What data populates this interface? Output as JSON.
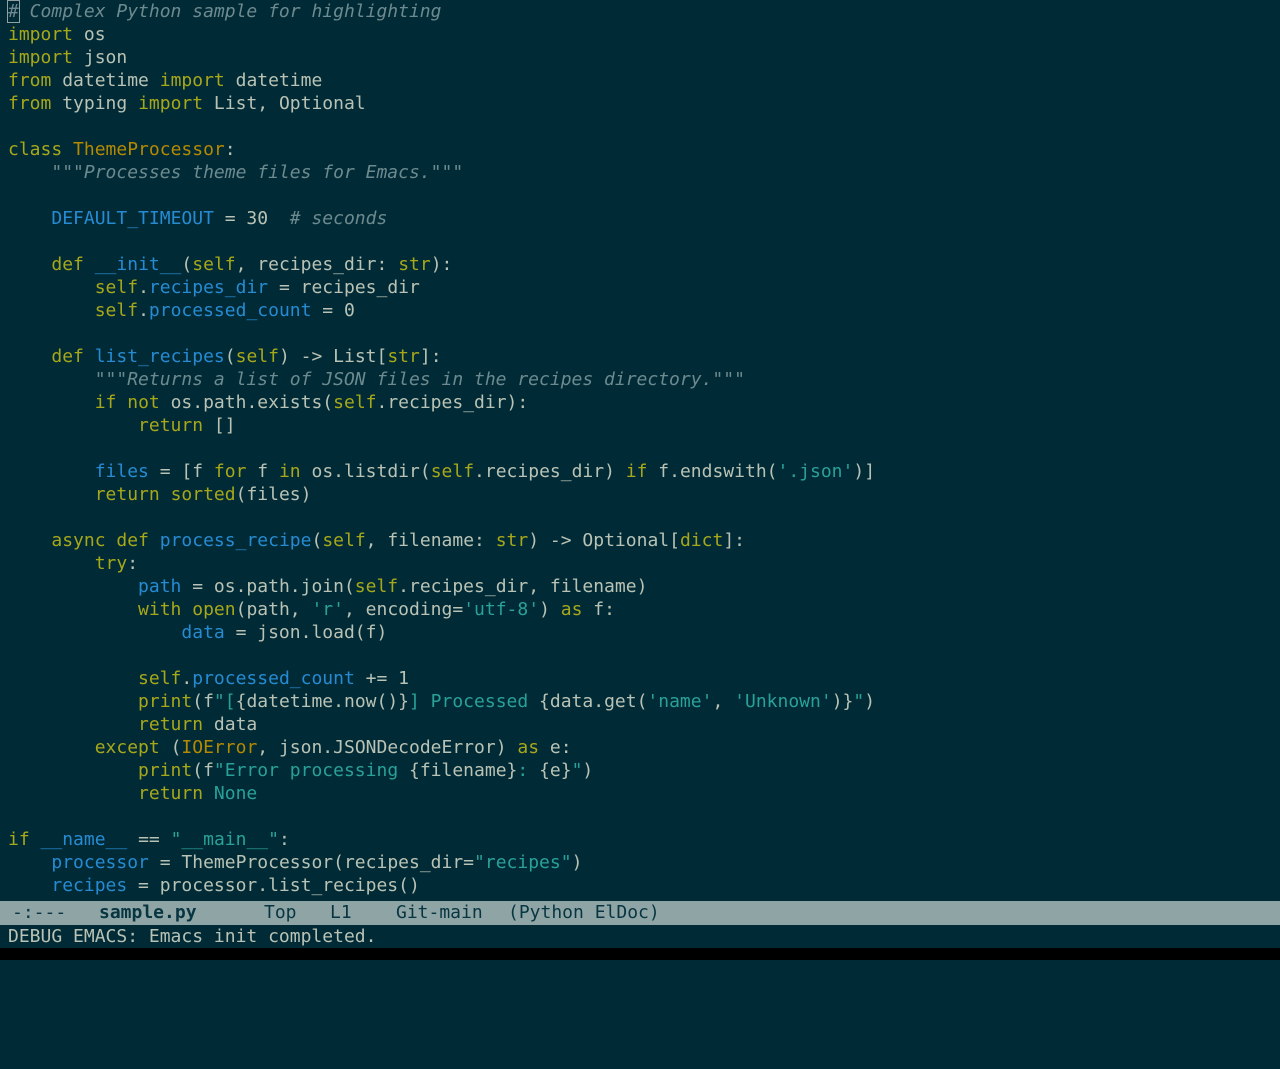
{
  "editor": {
    "lines": [
      [
        [
          "comment",
          "# Complex Python sample for highlighting"
        ]
      ],
      [
        [
          "kw",
          "import"
        ],
        [
          "plain",
          " os"
        ]
      ],
      [
        [
          "kw",
          "import"
        ],
        [
          "plain",
          " json"
        ]
      ],
      [
        [
          "kw",
          "from"
        ],
        [
          "plain",
          " datetime "
        ],
        [
          "kw",
          "import"
        ],
        [
          "plain",
          " datetime"
        ]
      ],
      [
        [
          "kw",
          "from"
        ],
        [
          "plain",
          " typing "
        ],
        [
          "kw",
          "import"
        ],
        [
          "plain",
          " List, Optional"
        ]
      ],
      [],
      [
        [
          "kw",
          "class"
        ],
        [
          "plain",
          " "
        ],
        [
          "builtin",
          "ThemeProcessor"
        ],
        [
          "plain",
          ":"
        ]
      ],
      [
        [
          "plain",
          "    "
        ],
        [
          "doc",
          "\"\"\"Processes theme files for Emacs.\"\"\""
        ]
      ],
      [],
      [
        [
          "plain",
          "    "
        ],
        [
          "var",
          "DEFAULT_TIMEOUT"
        ],
        [
          "plain",
          " = 30  "
        ],
        [
          "comment",
          "# seconds"
        ]
      ],
      [],
      [
        [
          "plain",
          "    "
        ],
        [
          "kw",
          "def"
        ],
        [
          "plain",
          " "
        ],
        [
          "fn",
          "__init__"
        ],
        [
          "plain",
          "("
        ],
        [
          "kw",
          "self"
        ],
        [
          "plain",
          ", recipes_dir: "
        ],
        [
          "kw",
          "str"
        ],
        [
          "plain",
          "):"
        ]
      ],
      [
        [
          "plain",
          "        "
        ],
        [
          "kw",
          "self"
        ],
        [
          "plain",
          "."
        ],
        [
          "var",
          "recipes_dir"
        ],
        [
          "plain",
          " = recipes_dir"
        ]
      ],
      [
        [
          "plain",
          "        "
        ],
        [
          "kw",
          "self"
        ],
        [
          "plain",
          "."
        ],
        [
          "var",
          "processed_count"
        ],
        [
          "plain",
          " = 0"
        ]
      ],
      [],
      [
        [
          "plain",
          "    "
        ],
        [
          "kw",
          "def"
        ],
        [
          "plain",
          " "
        ],
        [
          "fn",
          "list_recipes"
        ],
        [
          "plain",
          "("
        ],
        [
          "kw",
          "self"
        ],
        [
          "plain",
          ") -> List["
        ],
        [
          "kw",
          "str"
        ],
        [
          "plain",
          "]:"
        ]
      ],
      [
        [
          "plain",
          "        "
        ],
        [
          "doc",
          "\"\"\"Returns a list of JSON files in the recipes directory.\"\"\""
        ]
      ],
      [
        [
          "plain",
          "        "
        ],
        [
          "kw",
          "if"
        ],
        [
          "plain",
          " "
        ],
        [
          "kw",
          "not"
        ],
        [
          "plain",
          " os.path.exists("
        ],
        [
          "kw",
          "self"
        ],
        [
          "plain",
          ".recipes_dir):"
        ]
      ],
      [
        [
          "plain",
          "            "
        ],
        [
          "kw",
          "return"
        ],
        [
          "plain",
          " []"
        ]
      ],
      [],
      [
        [
          "plain",
          "        "
        ],
        [
          "var",
          "files"
        ],
        [
          "plain",
          " = [f "
        ],
        [
          "kw",
          "for"
        ],
        [
          "plain",
          " f "
        ],
        [
          "kw",
          "in"
        ],
        [
          "plain",
          " os.listdir("
        ],
        [
          "kw",
          "self"
        ],
        [
          "plain",
          ".recipes_dir) "
        ],
        [
          "kw",
          "if"
        ],
        [
          "plain",
          " f.endswith("
        ],
        [
          "str",
          "'.json'"
        ],
        [
          "plain",
          ")]"
        ]
      ],
      [
        [
          "plain",
          "        "
        ],
        [
          "kw",
          "return"
        ],
        [
          "plain",
          " "
        ],
        [
          "kw",
          "sorted"
        ],
        [
          "plain",
          "(files)"
        ]
      ],
      [],
      [
        [
          "plain",
          "    "
        ],
        [
          "kw",
          "async"
        ],
        [
          "plain",
          " "
        ],
        [
          "kw",
          "def"
        ],
        [
          "plain",
          " "
        ],
        [
          "fn",
          "process_recipe"
        ],
        [
          "plain",
          "("
        ],
        [
          "kw",
          "self"
        ],
        [
          "plain",
          ", filename: "
        ],
        [
          "kw",
          "str"
        ],
        [
          "plain",
          ") -> Optional["
        ],
        [
          "kw",
          "dict"
        ],
        [
          "plain",
          "]:"
        ]
      ],
      [
        [
          "plain",
          "        "
        ],
        [
          "kw",
          "try"
        ],
        [
          "plain",
          ":"
        ]
      ],
      [
        [
          "plain",
          "            "
        ],
        [
          "var",
          "path"
        ],
        [
          "plain",
          " = os.path.join("
        ],
        [
          "kw",
          "self"
        ],
        [
          "plain",
          ".recipes_dir, filename)"
        ]
      ],
      [
        [
          "plain",
          "            "
        ],
        [
          "kw",
          "with"
        ],
        [
          "plain",
          " "
        ],
        [
          "kw",
          "open"
        ],
        [
          "plain",
          "(path, "
        ],
        [
          "str",
          "'r'"
        ],
        [
          "plain",
          ", encoding="
        ],
        [
          "str",
          "'utf-8'"
        ],
        [
          "plain",
          ") "
        ],
        [
          "kw",
          "as"
        ],
        [
          "plain",
          " f:"
        ]
      ],
      [
        [
          "plain",
          "                "
        ],
        [
          "var",
          "data"
        ],
        [
          "plain",
          " = json.load(f)"
        ]
      ],
      [],
      [
        [
          "plain",
          "            "
        ],
        [
          "kw",
          "self"
        ],
        [
          "plain",
          "."
        ],
        [
          "var",
          "processed_count"
        ],
        [
          "plain",
          " += 1"
        ]
      ],
      [
        [
          "plain",
          "            "
        ],
        [
          "kw",
          "print"
        ],
        [
          "plain",
          "(f"
        ],
        [
          "str",
          "\"["
        ],
        [
          "plain",
          "{datetime.now()}"
        ],
        [
          "str",
          "] Processed "
        ],
        [
          "plain",
          "{data.get("
        ],
        [
          "str",
          "'name'"
        ],
        [
          "plain",
          ", "
        ],
        [
          "str",
          "'Unknown'"
        ],
        [
          "plain",
          ")}"
        ],
        [
          "str",
          "\""
        ],
        [
          "plain",
          ")"
        ]
      ],
      [
        [
          "plain",
          "            "
        ],
        [
          "kw",
          "return"
        ],
        [
          "plain",
          " data"
        ]
      ],
      [
        [
          "plain",
          "        "
        ],
        [
          "kw",
          "except"
        ],
        [
          "plain",
          " ("
        ],
        [
          "builtin",
          "IOError"
        ],
        [
          "plain",
          ", json.JSONDecodeError) "
        ],
        [
          "kw",
          "as"
        ],
        [
          "plain",
          " e:"
        ]
      ],
      [
        [
          "plain",
          "            "
        ],
        [
          "kw",
          "print"
        ],
        [
          "plain",
          "(f"
        ],
        [
          "str",
          "\"Error processing "
        ],
        [
          "plain",
          "{filename}"
        ],
        [
          "str",
          ": "
        ],
        [
          "plain",
          "{e}"
        ],
        [
          "str",
          "\""
        ],
        [
          "plain",
          ")"
        ]
      ],
      [
        [
          "plain",
          "            "
        ],
        [
          "kw",
          "return"
        ],
        [
          "plain",
          " "
        ],
        [
          "str",
          "None"
        ]
      ],
      [],
      [
        [
          "kw",
          "if"
        ],
        [
          "plain",
          " "
        ],
        [
          "var",
          "__name__"
        ],
        [
          "plain",
          " == "
        ],
        [
          "str",
          "\"__main__\""
        ],
        [
          "plain",
          ":"
        ]
      ],
      [
        [
          "plain",
          "    "
        ],
        [
          "var",
          "processor"
        ],
        [
          "plain",
          " = ThemeProcessor(recipes_dir="
        ],
        [
          "str",
          "\"recipes\""
        ],
        [
          "plain",
          ")"
        ]
      ],
      [
        [
          "plain",
          "    "
        ],
        [
          "var",
          "recipes"
        ],
        [
          "plain",
          " = processor.list_recipes()"
        ]
      ]
    ]
  },
  "modeline": {
    "status": "-:---",
    "buffer": "sample.py",
    "position": "Top",
    "line": "L1",
    "vc": "Git-main",
    "modes": "(Python ElDoc)"
  },
  "echo_area": {
    "message": "DEBUG EMACS: Emacs init completed."
  },
  "colors": {
    "background": "#002b36",
    "modeline_bg": "#8fa4a4",
    "keyword": "#a7a71a",
    "function": "#268bd2",
    "string": "#2aa198",
    "comment": "#6d8a8f"
  }
}
